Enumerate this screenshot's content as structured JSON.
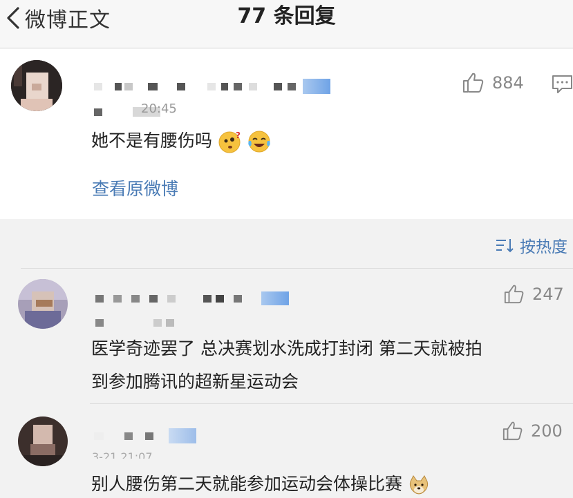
{
  "header": {
    "back_label": "微博正文",
    "title": "77 条回复"
  },
  "main_comment": {
    "time": "20:45",
    "text": "她不是有腰伤吗",
    "emojis": [
      "confused-face-icon",
      "laughing-crying-face-icon"
    ],
    "like_count": "884",
    "view_original": "查看原微博"
  },
  "sort": {
    "label": "按热度"
  },
  "replies": [
    {
      "text_line1": "医学奇迹罢了 总决赛划水洗成打封闭 第二天就被拍",
      "text_line2": "到参加腾讯的超新星运动会",
      "like_count": "247"
    },
    {
      "time": "3-21 21:07",
      "text": "别人腰伤第二天就能参加运动会体操比赛",
      "emojis": [
        "doge-face-icon"
      ],
      "like_count": "200"
    }
  ],
  "colors": {
    "link": "#4a7bb5",
    "count": "#888888",
    "background": "#f2f2f2"
  }
}
